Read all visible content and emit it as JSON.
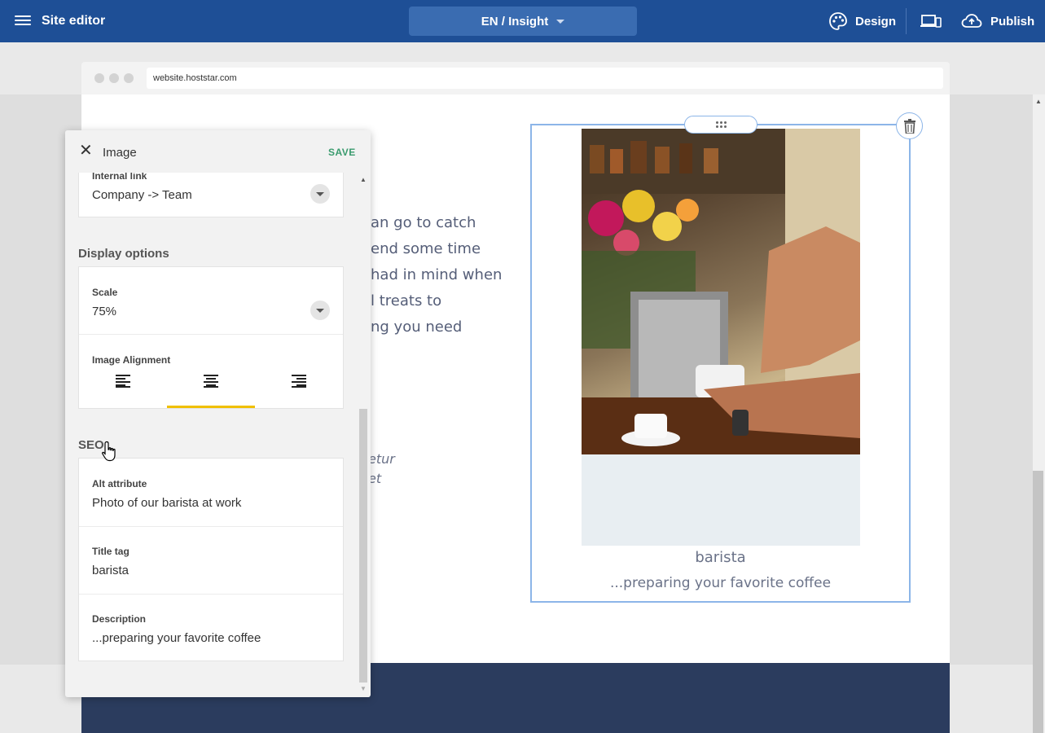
{
  "topbar": {
    "title": "Site editor",
    "language_select": "EN / Insight",
    "design_label": "Design",
    "publish_label": "Publish"
  },
  "browser": {
    "url": "website.hoststar.com"
  },
  "page": {
    "body_lines": [
      "an go to catch",
      "end some time",
      "had in mind when",
      "l treats to",
      "ng you need"
    ],
    "italic_lines": [
      "etur",
      "et"
    ],
    "image_caption_title": "barista",
    "image_caption_sub": "...preparing your favorite coffee"
  },
  "panel": {
    "title": "Image",
    "save_label": "SAVE",
    "internal_link": {
      "label": "Internal link",
      "value": "Company -> Team"
    },
    "display_options": {
      "heading": "Display options",
      "scale_label": "Scale",
      "scale_value": "75%",
      "alignment_label": "Image Alignment",
      "alignment_selected": "center"
    },
    "seo": {
      "heading": "SEO",
      "alt_label": "Alt attribute",
      "alt_value": "Photo of our barista at work",
      "title_label": "Title tag",
      "title_value": "barista",
      "description_label": "Description",
      "description_value": "...preparing your favorite coffee"
    }
  },
  "colors": {
    "topbar": "#1e4f96",
    "accent_save": "#3a9b6e",
    "alignment_indicator": "#f0c000",
    "selection_border": "#8cb5e8",
    "footer": "#2b3c5e"
  }
}
